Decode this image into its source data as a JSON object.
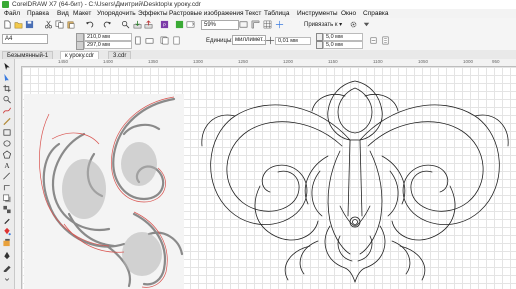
{
  "window": {
    "title": "CorelDRAW X7 (64-бит) - C:\\Users\\Дмитрий\\Desktop\\к уроку.cdr"
  },
  "menu": {
    "items": [
      "Файл",
      "Правка",
      "Вид",
      "Макет",
      "Упорядочить",
      "Эффекты",
      "Растровые изображения",
      "Текст",
      "Таблица",
      "Инструменты",
      "Окно",
      "Справка"
    ]
  },
  "toolbar": {
    "zoom": "59%",
    "snap": "Привязать к"
  },
  "propbar": {
    "page_size": "A4",
    "width": "210,0 мм",
    "height": "297,0 мм",
    "units_label": "Единицы:",
    "units_value": "миллимет...",
    "nudge": "0,01 мм",
    "dup_x": "5,0 мм",
    "dup_y": "5,0 мм"
  },
  "tabs": [
    "Безымянный-1",
    "к уроку.cdr",
    "3.cdr"
  ],
  "ruler": {
    "labels": [
      "1450",
      "1400",
      "1350",
      "1300",
      "1250",
      "1200",
      "1150",
      "1100",
      "1050",
      "1000",
      "950"
    ]
  },
  "colors": {
    "accent": "#3aaa35",
    "stroke": "#222222",
    "trace": "#d9534f"
  }
}
